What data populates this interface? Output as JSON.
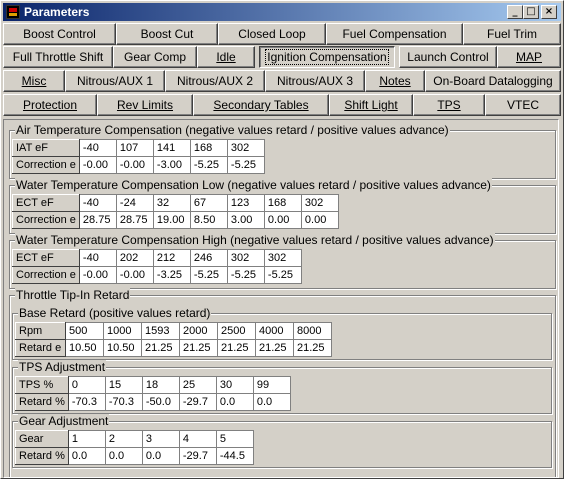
{
  "window": {
    "title": "Parameters",
    "buttons": {
      "minimize": "_",
      "maximize": "□",
      "close": "×"
    }
  },
  "tabs": {
    "row1": [
      "Boost Control",
      "Boost Cut",
      "Closed Loop",
      "Fuel Compensation",
      "Fuel Trim"
    ],
    "row2": [
      "Full Throttle Shift",
      "Gear Comp",
      "Idle",
      "Ignition Compensation",
      "Launch Control",
      "MAP"
    ],
    "row3": [
      "Misc",
      "Nitrous/AUX 1",
      "Nitrous/AUX 2",
      "Nitrous/AUX 3",
      "Notes",
      "On-Board Datalogging"
    ],
    "row4": [
      "Protection",
      "Rev Limits",
      "Secondary Tables",
      "Shift Light",
      "TPS",
      "VTEC"
    ],
    "active": "Ignition Compensation"
  },
  "air_temp": {
    "title": "Air Temperature Compensation (negative values retard / positive values advance)",
    "row_labels": [
      "IAT eF",
      "Correction e"
    ],
    "iat": [
      "-40",
      "107",
      "141",
      "168",
      "302"
    ],
    "correction": [
      "-0.00",
      "-0.00",
      "-3.00",
      "-5.25",
      "-5.25"
    ]
  },
  "water_low": {
    "title": "Water Temperature Compensation Low (negative values retard / positive values advance)",
    "row_labels": [
      "ECT eF",
      "Correction e"
    ],
    "ect": [
      "-40",
      "-24",
      "32",
      "67",
      "123",
      "168",
      "302"
    ],
    "correction": [
      "28.75",
      "28.75",
      "19.00",
      "8.50",
      "3.00",
      "0.00",
      "0.00"
    ]
  },
  "water_high": {
    "title": "Water Temperature Compensation High (negative values retard / positive values advance)",
    "row_labels": [
      "ECT eF",
      "Correction e"
    ],
    "ect": [
      "-40",
      "202",
      "212",
      "246",
      "302",
      "302"
    ],
    "correction": [
      "-0.00",
      "-0.00",
      "-3.25",
      "-5.25",
      "-5.25",
      "-5.25"
    ]
  },
  "tip_in": {
    "title": "Throttle Tip-In Retard",
    "base": {
      "title": "Base Retard (positive values retard)",
      "row_labels": [
        "Rpm",
        "Retard e"
      ],
      "rpm": [
        "500",
        "1000",
        "1593",
        "2000",
        "2500",
        "4000",
        "8000"
      ],
      "retard": [
        "10.50",
        "10.50",
        "21.25",
        "21.25",
        "21.25",
        "21.25",
        "21.25"
      ]
    },
    "tps": {
      "title": "TPS Adjustment",
      "row_labels": [
        "TPS %",
        "Retard %"
      ],
      "tps": [
        "0",
        "15",
        "18",
        "25",
        "30",
        "99"
      ],
      "retard": [
        "-70.3",
        "-70.3",
        "-50.0",
        "-29.7",
        "0.0",
        "0.0"
      ]
    },
    "gear": {
      "title": "Gear Adjustment",
      "row_labels": [
        "Gear",
        "Retard %"
      ],
      "gear": [
        "1",
        "2",
        "3",
        "4",
        "5"
      ],
      "retard": [
        "0.0",
        "0.0",
        "0.0",
        "-29.7",
        "-44.5"
      ]
    }
  }
}
